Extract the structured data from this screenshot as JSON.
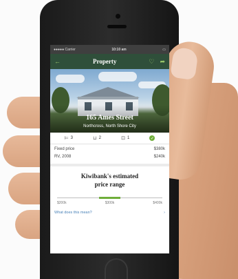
{
  "status_bar": {
    "carrier": "●●●●● Carrier",
    "time": "10:10 am",
    "battery": "▭"
  },
  "nav": {
    "back_icon": "arrow-left-icon",
    "title": "Property",
    "heart_icon": "heart-icon",
    "share_icon": "share-icon"
  },
  "listing": {
    "address": "165 Ames Street",
    "suburb": "Northcross, North Shore City",
    "features": [
      {
        "icon": "bed-icon",
        "glyph": "⊨",
        "value": "3"
      },
      {
        "icon": "bath-icon",
        "glyph": "⊔",
        "value": "2"
      },
      {
        "icon": "car-icon",
        "glyph": "⊡",
        "value": "1"
      }
    ],
    "rows": [
      {
        "label": "Fixed price",
        "value": "$380k"
      },
      {
        "label": "RV, 2008",
        "value": "$240k"
      }
    ]
  },
  "estimate": {
    "title_line1": "Kiwibank's estimated",
    "title_line2": "price range",
    "range_labels": [
      "$200k",
      "$300k",
      "$400k"
    ],
    "range_fill": [
      0.4,
      0.6
    ],
    "link": "What does this mean?",
    "link_chevron": "›"
  },
  "colors": {
    "nav_bg": "#2f4f3a",
    "accent_green": "#6fae3a",
    "link_blue": "#4a82b8"
  }
}
